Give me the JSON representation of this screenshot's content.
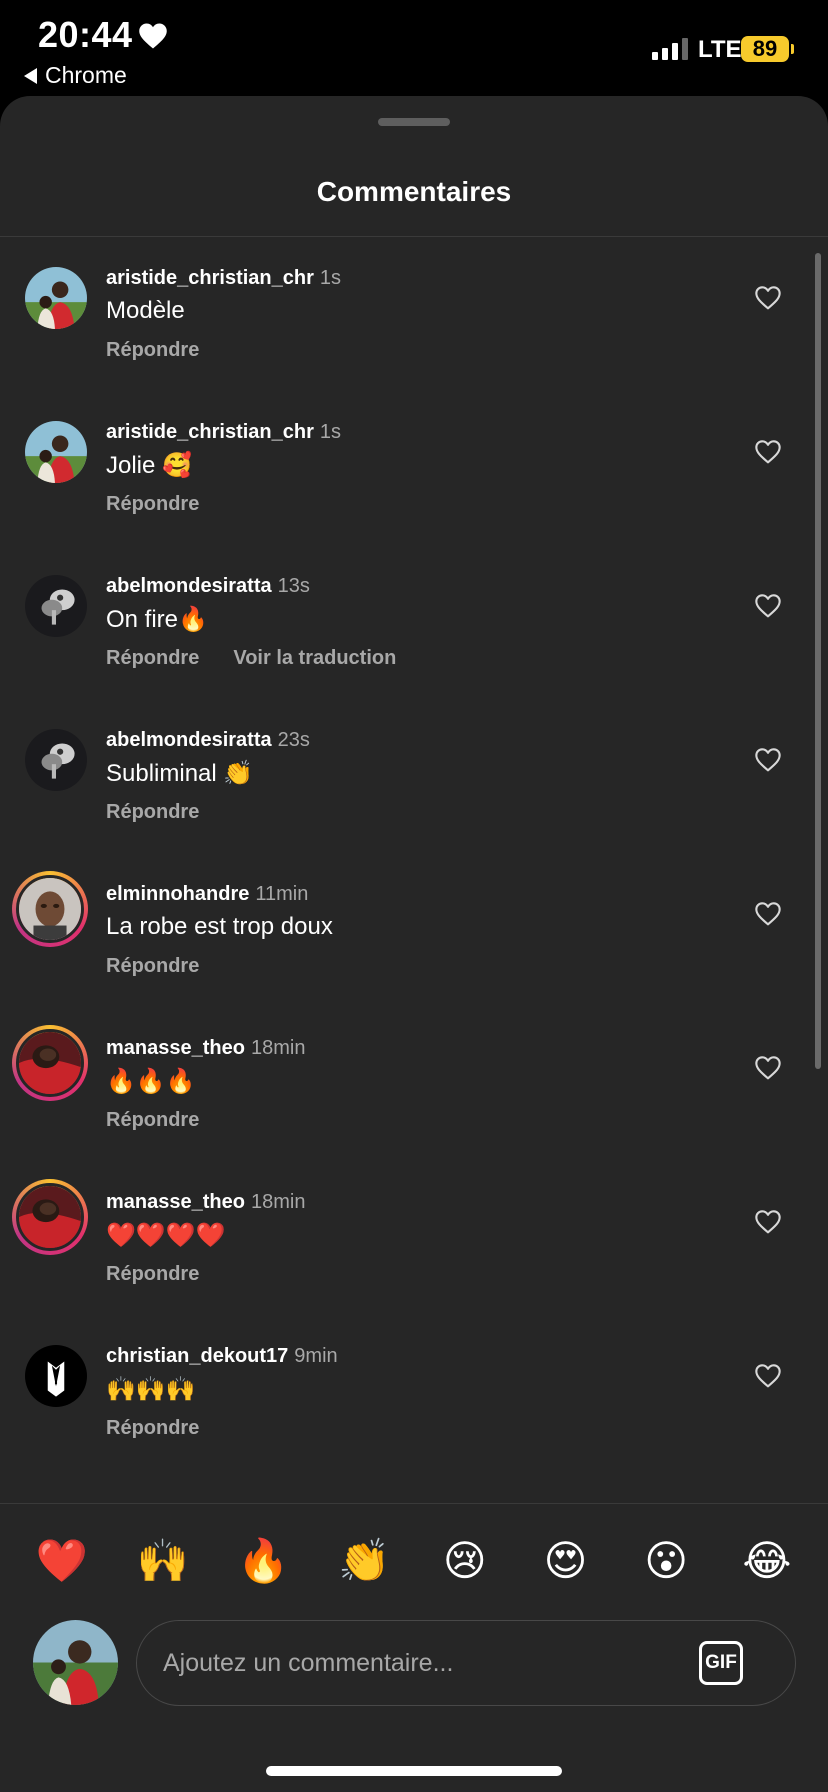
{
  "status_bar": {
    "time": "20:44",
    "back_app": "Chrome",
    "network": "LTE",
    "battery": "89",
    "battery_color": "#f7ca2c"
  },
  "sheet": {
    "title": "Commentaires"
  },
  "comments": [
    {
      "user": "aristide_christian_chr",
      "time": "1s",
      "text": "Modèle",
      "reply": "Répondre",
      "translate": "",
      "avatar": "couple-photo",
      "story_ring": false
    },
    {
      "user": "aristide_christian_chr",
      "time": "1s",
      "text": "Jolie 🥰",
      "reply": "Répondre",
      "translate": "",
      "avatar": "couple-photo",
      "story_ring": false
    },
    {
      "user": "abelmondesiratta",
      "time": "13s",
      "text": "On fire🔥",
      "reply": "Répondre",
      "translate": "Voir la traduction",
      "avatar": "dark-portrait",
      "story_ring": false
    },
    {
      "user": "abelmondesiratta",
      "time": "23s",
      "text": "Subliminal 👏",
      "reply": "Répondre",
      "translate": "",
      "avatar": "dark-portrait",
      "story_ring": false
    },
    {
      "user": "elminnohandre",
      "time": "11min",
      "text": "La robe est trop doux",
      "reply": "Répondre",
      "translate": "",
      "avatar": "face-photo",
      "story_ring": true
    },
    {
      "user": "manasse_theo",
      "time": "18min",
      "text": "🔥🔥🔥",
      "reply": "Répondre",
      "translate": "",
      "avatar": "red-shirt-photo",
      "story_ring": true
    },
    {
      "user": "manasse_theo",
      "time": "18min",
      "text": "❤️❤️❤️❤️",
      "reply": "Répondre",
      "translate": "",
      "avatar": "red-shirt-photo",
      "story_ring": true
    },
    {
      "user": "christian_dekout17",
      "time": "9min",
      "text": "🙌🙌🙌",
      "reply": "Répondre",
      "translate": "",
      "avatar": "tuxedo-logo",
      "story_ring": false
    }
  ],
  "emoji_bar": [
    "❤️",
    "🙌",
    "🔥",
    "👏",
    "😢",
    "😍",
    "😮",
    "😂"
  ],
  "composer": {
    "placeholder": "Ajoutez un commentaire...",
    "gif_label": "GIF"
  },
  "colors": {
    "sheet_bg": "#262626",
    "secondary_text": "#a8a8a8"
  }
}
